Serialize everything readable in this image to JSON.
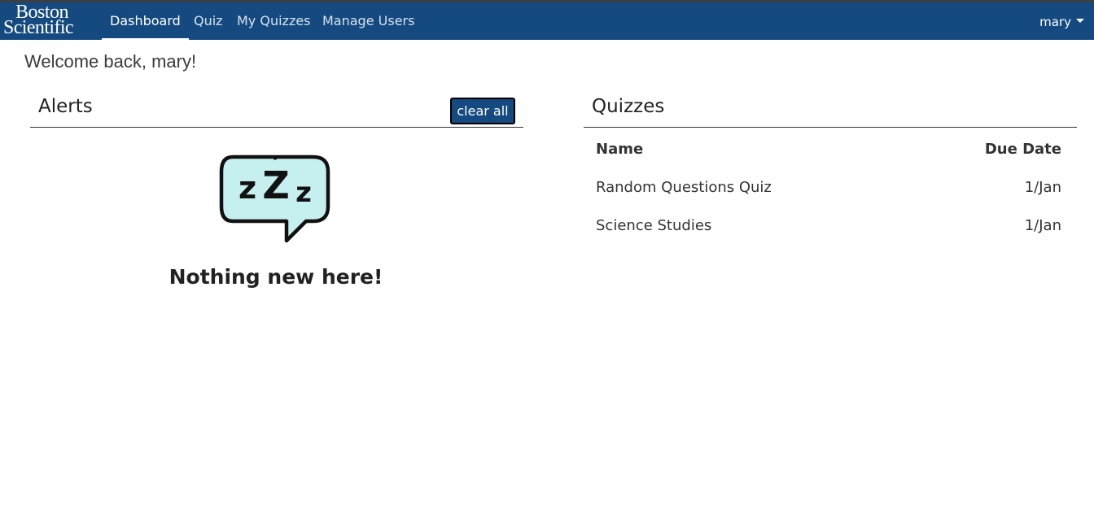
{
  "navbar": {
    "logo_line1": "Boston",
    "logo_line2": "Scientific",
    "items": [
      {
        "label": "Dashboard",
        "active": true
      },
      {
        "label": "Quiz",
        "active": false
      },
      {
        "label": "My Quizzes",
        "active": false
      },
      {
        "label": "Manage Users",
        "active": false
      }
    ],
    "user": "mary",
    "colors": {
      "bar": "#154a80",
      "text": "#ffffff"
    }
  },
  "welcome": "Welcome back, mary!",
  "alerts": {
    "title": "Alerts",
    "clear_label": "clear all",
    "icon": "sleep-zzz-icon",
    "zzz": [
      "z",
      "Z",
      "z"
    ],
    "empty_message": "Nothing new here!"
  },
  "quizzes": {
    "title": "Quizzes",
    "columns": [
      "Name",
      "Due Date"
    ],
    "rows": [
      {
        "name": "Random Questions Quiz",
        "due": "1/Jan"
      },
      {
        "name": "Science Studies",
        "due": "1/Jan"
      }
    ]
  }
}
